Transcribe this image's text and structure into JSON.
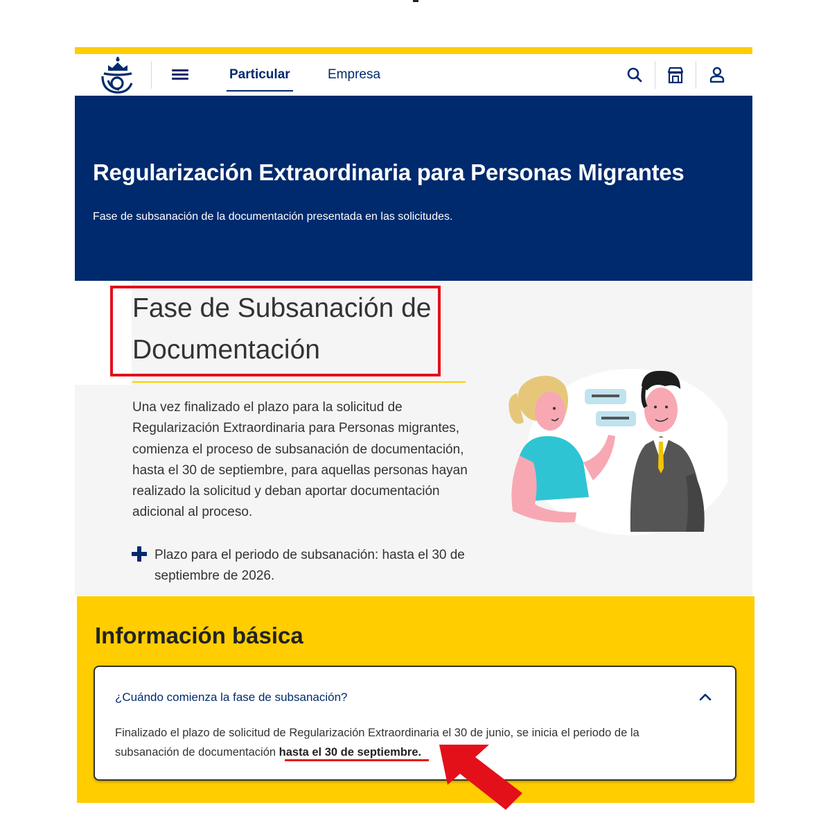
{
  "header": {
    "nav_tabs": [
      {
        "label": "Particular",
        "active": true
      },
      {
        "label": "Empresa",
        "active": false
      }
    ],
    "icons": [
      "correos-logo",
      "menu-icon",
      "search-icon",
      "store-icon",
      "user-icon"
    ]
  },
  "hero": {
    "title": "Regularización Extraordinaria para Personas Migrantes",
    "subtitle": "Fase de subsanación de la documentación presentada en las solicitudes."
  },
  "section": {
    "title_line1": "Fase de Subsanación de",
    "title_line2": "Documentación",
    "body": "Una vez finalizado el plazo para la solicitud de Regularización Extraordinaria para Personas migrantes, comienza el proceso de subsanación de documentación, hasta el 30 de septiembre, para aquellas personas hayan realizado la solicitud y deban aportar documentación adicional al proceso.",
    "bullet": "Plazo para el periodo de subsanación: hasta el 30 de septiembre de 2026."
  },
  "info": {
    "title": "Información básica",
    "faq": {
      "question": "¿Cuándo comienza la fase de subsanación?",
      "answer_pre": "Finalizado el plazo de solicitud de Regularización Extraordinaria el 30 de junio, se inicia el periodo de la subsanación de documentación ",
      "answer_bold": "hasta el 30 de septiembre."
    }
  },
  "colors": {
    "brand_blue": "#002a6e",
    "brand_yellow": "#ffcd00",
    "annotation_red": "#e3101a"
  }
}
